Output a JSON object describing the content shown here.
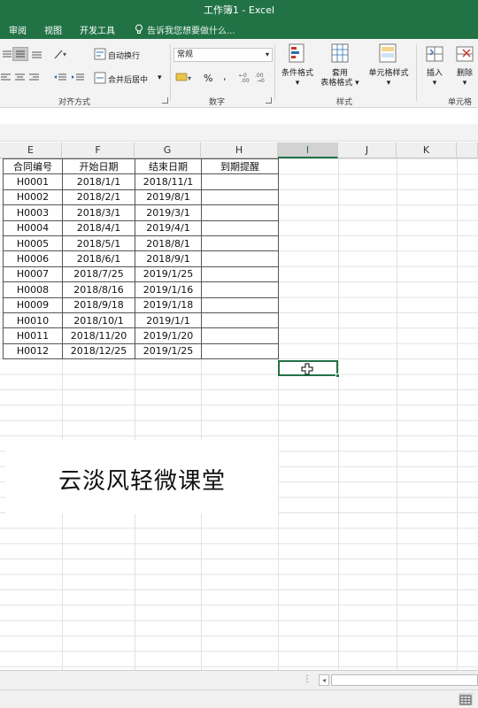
{
  "window": {
    "title": "工作簿1 - Excel"
  },
  "tabs": [
    "审阅",
    "视图",
    "开发工具"
  ],
  "tellme": "告诉我您想要做什么...",
  "ribbon": {
    "wrap_text": "自动换行",
    "merge_center": "合并后居中",
    "align_group": "对齐方式",
    "number_format": "常规",
    "percent": "%",
    "comma": ",",
    "number_group": "数字",
    "conditional_format": "条件格式",
    "table_format_1": "套用",
    "table_format_2": "表格格式",
    "cell_styles": "单元格样式",
    "styles_group": "样式",
    "insert": "插入",
    "delete": "删除",
    "cells_group": "单元格"
  },
  "columns": [
    "E",
    "F",
    "G",
    "H",
    "I",
    "J",
    "K"
  ],
  "selected_column": "I",
  "table": {
    "headers": [
      "合同编号",
      "开始日期",
      "结束日期",
      "到期提醒"
    ],
    "rows": [
      [
        "H0001",
        "2018/1/1",
        "2018/11/1",
        ""
      ],
      [
        "H0002",
        "2018/2/1",
        "2019/8/1",
        ""
      ],
      [
        "H0003",
        "2018/3/1",
        "2019/3/1",
        ""
      ],
      [
        "H0004",
        "2018/4/1",
        "2019/4/1",
        ""
      ],
      [
        "H0005",
        "2018/5/1",
        "2018/8/1",
        ""
      ],
      [
        "H0006",
        "2018/6/1",
        "2018/9/1",
        ""
      ],
      [
        "H0007",
        "2018/7/25",
        "2019/1/25",
        ""
      ],
      [
        "H0008",
        "2018/8/16",
        "2019/1/16",
        ""
      ],
      [
        "H0009",
        "2018/9/18",
        "2019/1/18",
        ""
      ],
      [
        "H0010",
        "2018/10/1",
        "2019/1/1",
        ""
      ],
      [
        "H0011",
        "2018/11/20",
        "2019/1/20",
        ""
      ],
      [
        "H0012",
        "2018/12/25",
        "2019/1/25",
        ""
      ]
    ]
  },
  "overlay_text": "云淡风轻微课堂",
  "scroll_dots": "⋮",
  "icons": {
    "tellme": "lightbulb-icon",
    "cursor": "plus-cursor-icon"
  },
  "colors": {
    "excel_green": "#217346"
  }
}
